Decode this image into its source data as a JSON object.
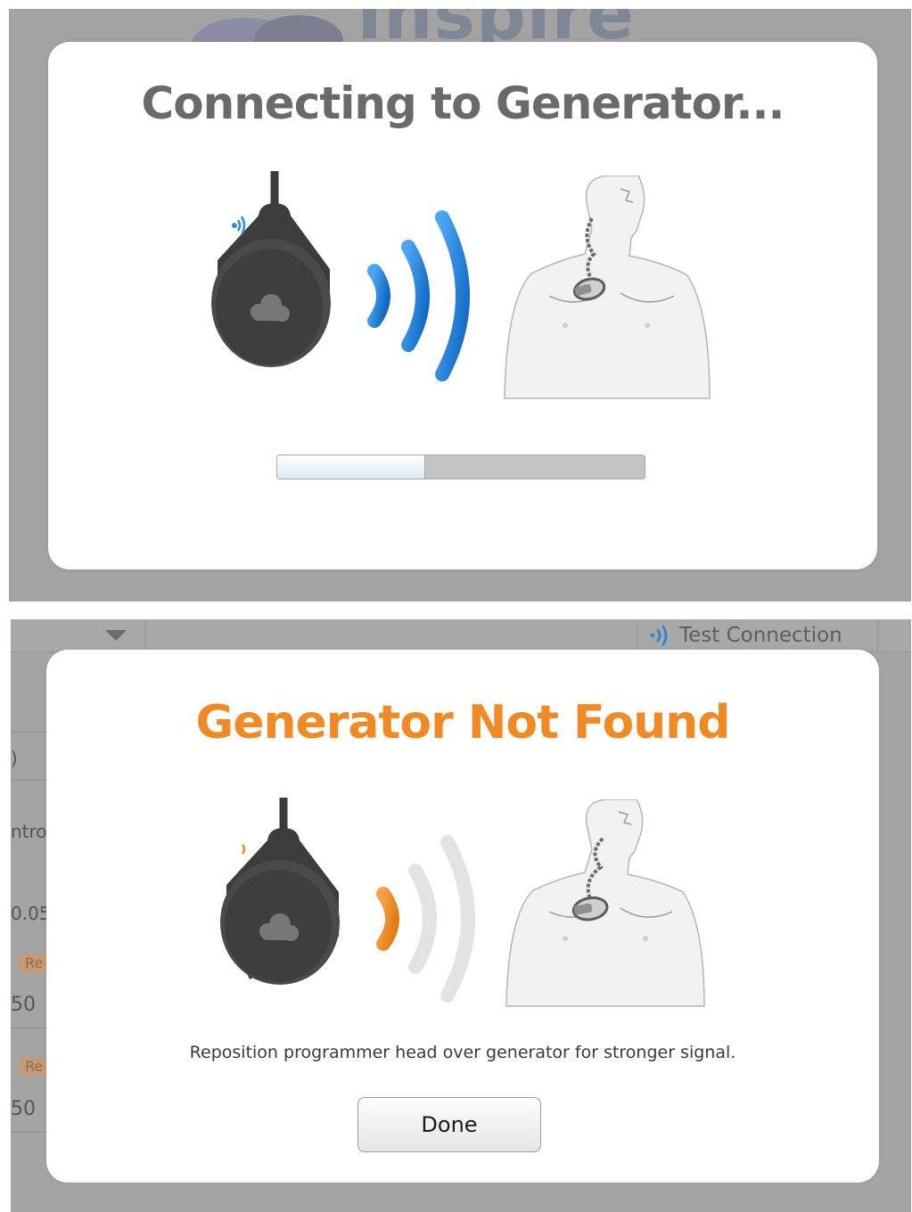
{
  "connecting_dialog": {
    "title": "Connecting to Generator...",
    "progress": 0.4,
    "background_logo_text": "Inspire"
  },
  "not_found_dialog": {
    "title": "Generator Not Found",
    "message": "Reposition programmer head over generator for stronger signal.",
    "done_label": "Done",
    "background": {
      "test_connection_label": "Test Connection",
      "fragments": [
        "ntrol",
        "0.05",
        "Re",
        "50",
        "Re",
        "50",
        ")"
      ]
    }
  },
  "colors": {
    "signal_blue": "#1a7fd9",
    "signal_orange": "#f08a24",
    "title_gray": "#6a6a6a",
    "overlay_gray": "#a3a3a3"
  },
  "icons": [
    "programmer-head-icon",
    "signal-waves-icon",
    "patient-torso-icon",
    "wireless-small-icon"
  ]
}
